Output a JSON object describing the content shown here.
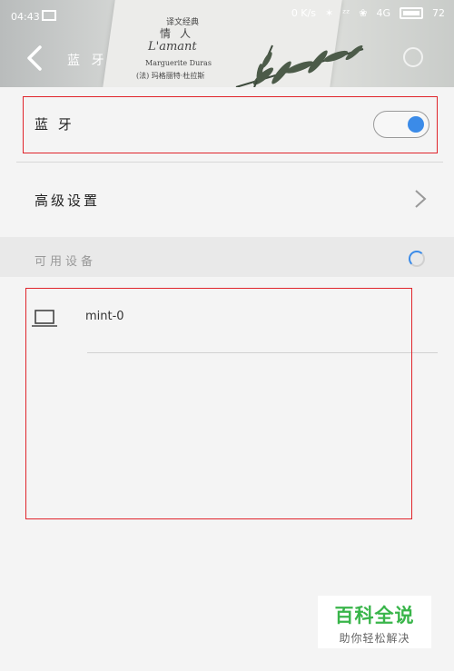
{
  "status_bar": {
    "time": "04:43",
    "speed": "0 K/s",
    "signal_text": "4G",
    "battery": "72"
  },
  "header": {
    "title": "蓝 牙",
    "background_text": {
      "line1": "译文经典",
      "line2": "情人",
      "line3": "L'amant",
      "line4": "Marguerite Duras",
      "line5": "(法) 玛格丽特·杜拉斯"
    }
  },
  "bluetooth": {
    "label": "蓝 牙",
    "enabled": true,
    "toggle_color": "#3b8be8"
  },
  "advanced": {
    "label": "高级设置"
  },
  "available_section": {
    "label": "可用设备"
  },
  "devices": [
    {
      "name": "mint-0",
      "icon": "laptop-icon"
    }
  ],
  "watermark": {
    "title": "百科全说",
    "subtitle": "助你轻松解决"
  },
  "colors": {
    "accent": "#3b8be8",
    "highlight": "#e0242b",
    "watermark_green": "#39b54a"
  }
}
